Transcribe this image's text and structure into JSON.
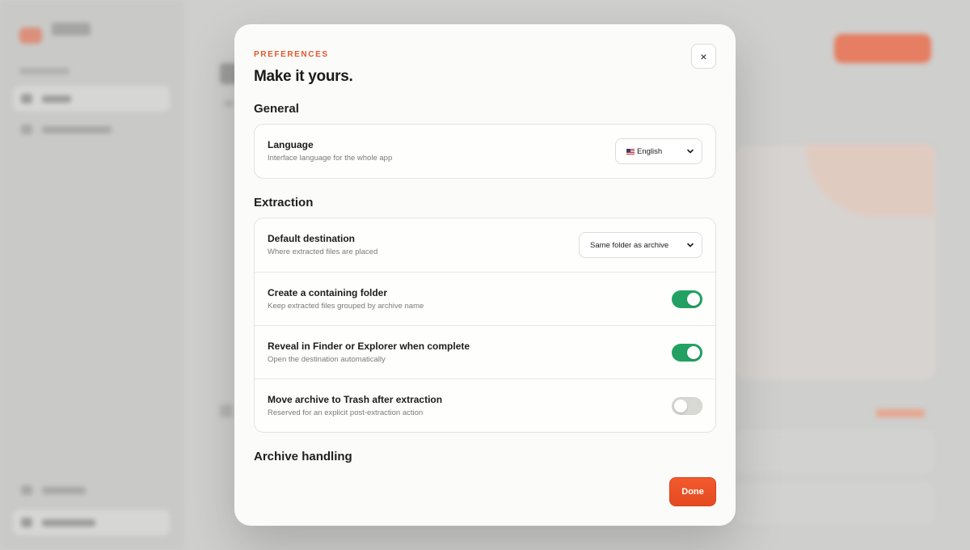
{
  "modal": {
    "eyebrow": "PREFERENCES",
    "title": "Make it yours.",
    "close_label": "×",
    "done_label": "Done"
  },
  "sections": {
    "general": {
      "title": "General",
      "language": {
        "label": "Language",
        "description": "Interface language for the whole app",
        "selected": "English",
        "flag": "us-flag-icon"
      }
    },
    "extraction": {
      "title": "Extraction",
      "destination": {
        "label": "Default destination",
        "description": "Where extracted files are placed",
        "selected": "Same folder as archive"
      },
      "containing_folder": {
        "label": "Create a containing folder",
        "description": "Keep extracted files grouped by archive name",
        "enabled": true
      },
      "reveal": {
        "label": "Reveal in Finder or Explorer when complete",
        "description": "Open the destination automatically",
        "enabled": true
      },
      "trash": {
        "label": "Move archive to Trash after extraction",
        "description": "Reserved for an explicit post-extraction action",
        "enabled": false
      }
    },
    "archive_handling": {
      "title": "Archive handling"
    }
  },
  "colors": {
    "accent": "#e4572e",
    "toggle_on": "#22a163",
    "toggle_off": "#d8d8d5"
  }
}
